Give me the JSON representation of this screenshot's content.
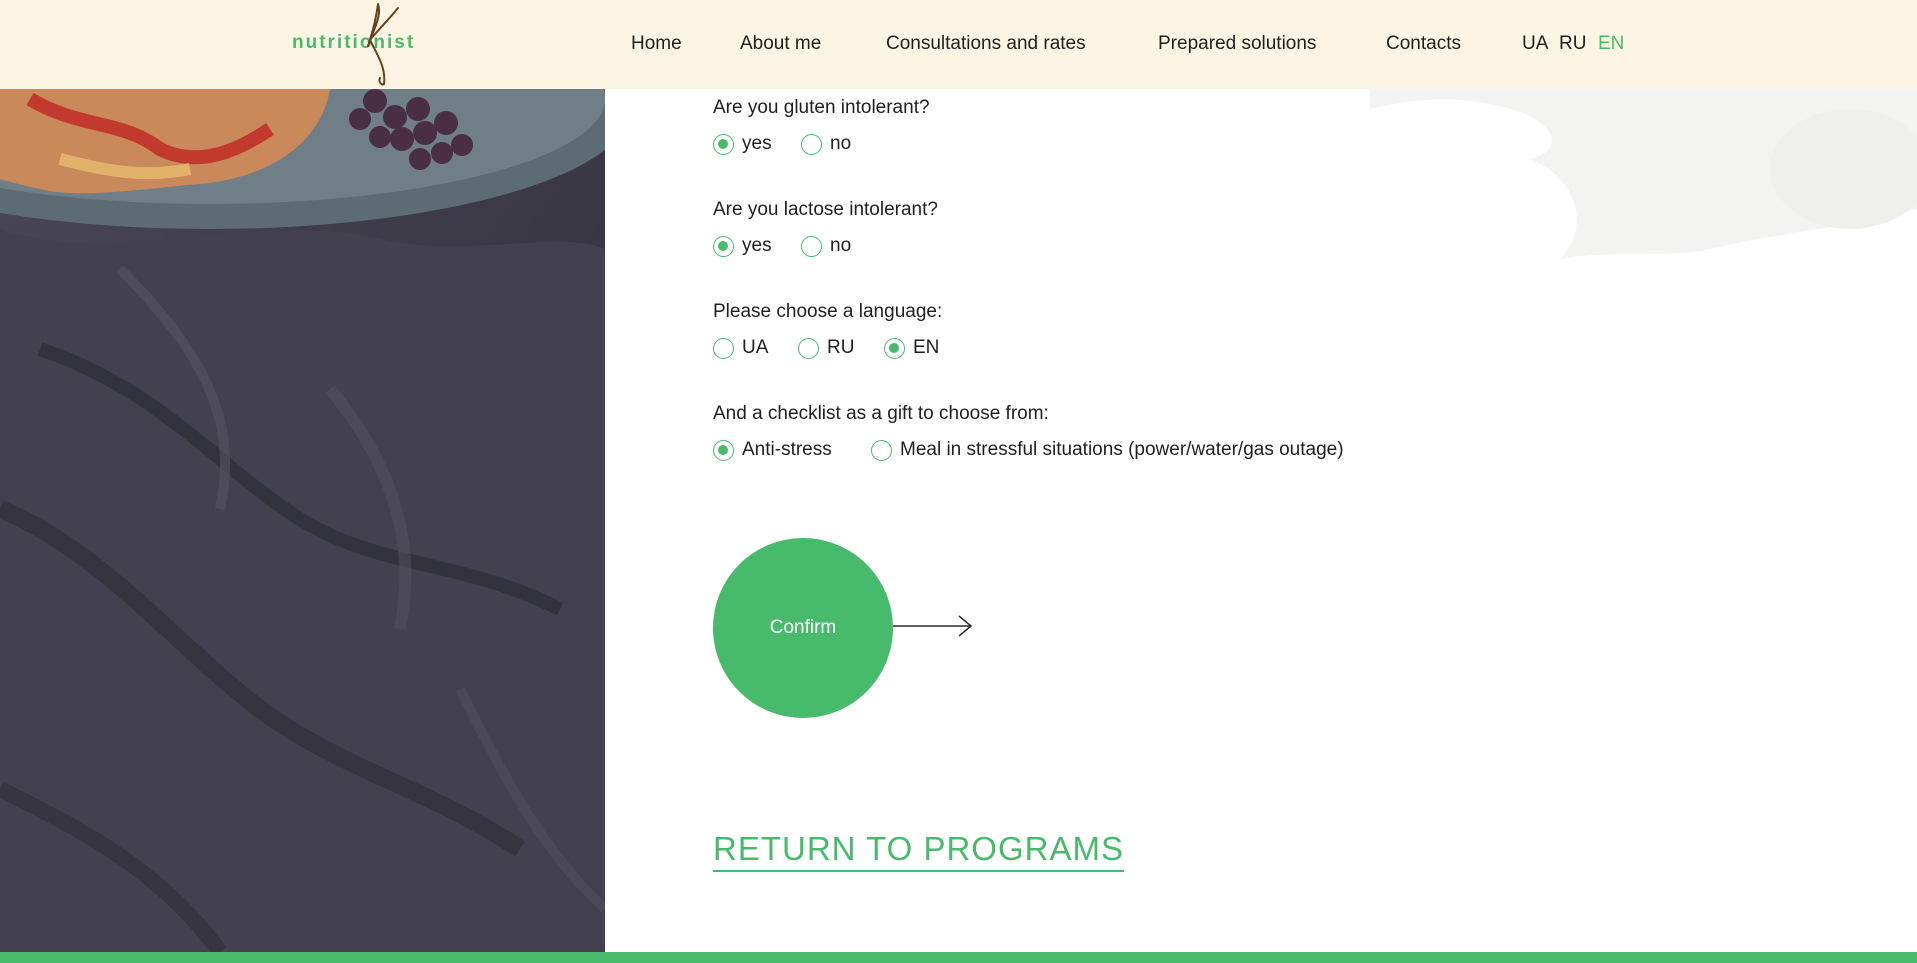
{
  "brand": {
    "logo_text": "nutritionist",
    "accent_color": "#47bb6b"
  },
  "nav": {
    "items": [
      {
        "label": "Home"
      },
      {
        "label": "About me"
      },
      {
        "label": "Consultations and rates"
      },
      {
        "label": "Prepared solutions"
      },
      {
        "label": "Contacts"
      }
    ],
    "languages": [
      {
        "label": "UA",
        "active": false
      },
      {
        "label": "RU",
        "active": false
      },
      {
        "label": "EN",
        "active": true
      }
    ]
  },
  "form": {
    "gluten": {
      "question": "Are you gluten intolerant?",
      "options": [
        {
          "label": "yes",
          "checked": true
        },
        {
          "label": "no",
          "checked": false
        }
      ]
    },
    "lactose": {
      "question": "Are you lactose intolerant?",
      "options": [
        {
          "label": "yes",
          "checked": true
        },
        {
          "label": "no",
          "checked": false
        }
      ]
    },
    "language": {
      "question": "Please choose a language:",
      "options": [
        {
          "label": "UA",
          "checked": false
        },
        {
          "label": "RU",
          "checked": false
        },
        {
          "label": "EN",
          "checked": true
        }
      ]
    },
    "checklist": {
      "question": "And a checklist as a gift to choose from:",
      "options": [
        {
          "label": "Anti-stress",
          "checked": true
        },
        {
          "label": "Meal in stressful situations (power/water/gas outage)",
          "checked": false
        }
      ]
    },
    "confirm_label": "Confirm",
    "return_label": "RETURN TO PROGRAMS"
  }
}
